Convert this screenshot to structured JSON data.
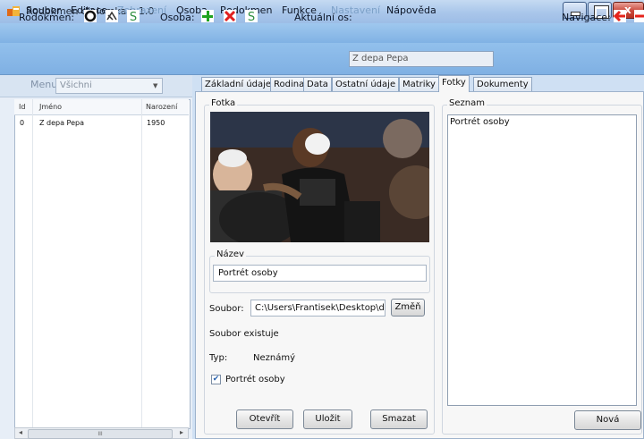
{
  "window": {
    "title": "Rodokmen diplomka v 1.0"
  },
  "menu": {
    "items": [
      {
        "label": "Soubor",
        "enabled": true
      },
      {
        "label": "Editace",
        "enabled": true
      },
      {
        "label": "Zobrazení",
        "enabled": false
      },
      {
        "label": "Osoba",
        "enabled": true
      },
      {
        "label": "Rodokmen",
        "enabled": true
      },
      {
        "label": "Funkce",
        "enabled": true
      },
      {
        "label": "Nastavení",
        "enabled": false
      },
      {
        "label": "Nápověda",
        "enabled": true
      }
    ]
  },
  "toolbar": {
    "rodokmen_label": "Rodokmen:",
    "osoba_label": "Osoba:",
    "aktualni_label": "Aktuální os:",
    "aktualni_value": "Z depa Pepa",
    "navigace_label": "Navigace:"
  },
  "left_pane": {
    "menu_label": "Menu",
    "filter_value": "Všichni",
    "columns": [
      "Id",
      "Jméno",
      "Narození"
    ],
    "rows": [
      {
        "id": "0",
        "name": "Z depa Pepa",
        "born": "1950"
      }
    ],
    "scroll_thumb": "III"
  },
  "tabs": [
    "Základní údaje",
    "Rodina",
    "Data",
    "Ostatní údaje",
    "Matriky",
    "Fotky",
    "Dokumenty"
  ],
  "active_tab": "Fotky",
  "photo_panel": {
    "group_title": "Fotka",
    "name_group_title": "Název",
    "name_value": "Portrét osoby",
    "file_label": "Soubor:",
    "file_value": "C:\\Users\\Frantisek\\Desktop\\dok",
    "change_button": "Změň",
    "file_status": "Soubor existuje",
    "type_label": "Typ:",
    "type_value": "Neznámý",
    "portrait_checkbox_label": "Portrét osoby",
    "portrait_checked": true,
    "open_button": "Otevřít",
    "save_button": "Uložit",
    "delete_button": "Smazat"
  },
  "list_panel": {
    "group_title": "Seznam",
    "items": [
      "Portrét osoby"
    ],
    "new_button": "Nová"
  },
  "colors": {
    "green_icon": "#1fa21f",
    "red_icon": "#e01f1f",
    "nav_arrow": "#e5231b"
  }
}
